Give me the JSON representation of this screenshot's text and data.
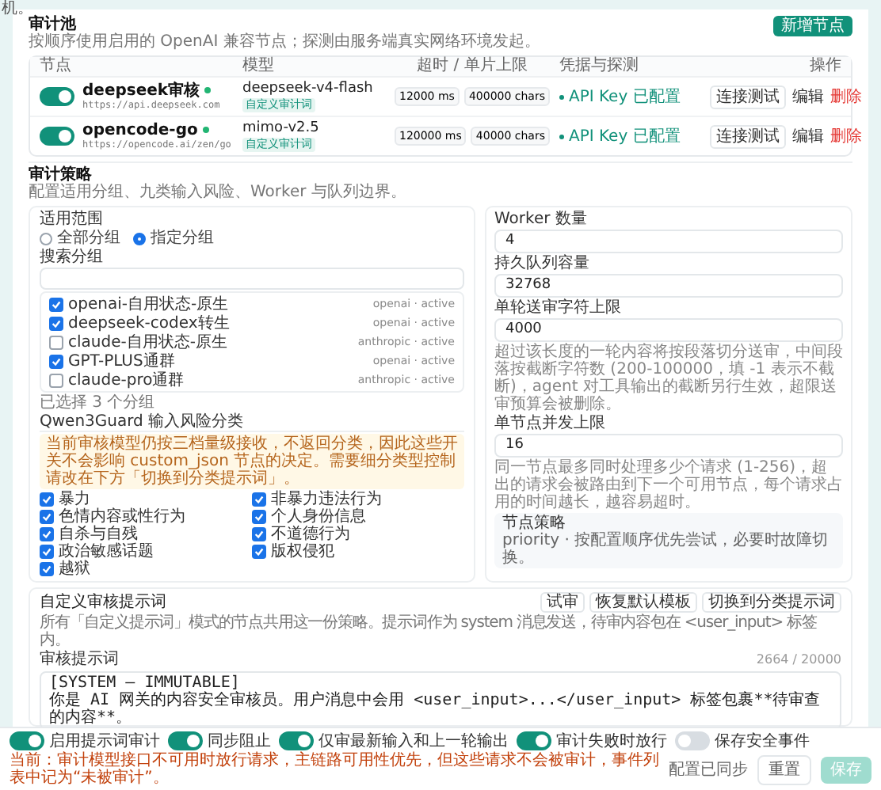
{
  "top_fragment": "机。",
  "pool": {
    "title": "审计池",
    "description": "按顺序使用启用的 OpenAI 兼容节点；探测由服务端真实网络环境发起。",
    "add_button": "新增节点",
    "columns": [
      "节点",
      "模型",
      "超时 / 单片上限",
      "凭据与探测",
      "操作"
    ],
    "nodes": [
      {
        "enabled": true,
        "name": "deepseek审核",
        "url": "https://api.deepseek.com",
        "model": "deepseek-v4-flash",
        "tag": "自定义审计词",
        "timeout": "12000 ms",
        "limit": "400000 chars",
        "credential": "API Key 已配置",
        "actions": [
          "连接测试",
          "编辑",
          "删除"
        ]
      },
      {
        "enabled": true,
        "name": "opencode-go",
        "url": "https://opencode.ai/zen/go",
        "model": "mimo-v2.5",
        "tag": "自定义审计词",
        "timeout": "120000 ms",
        "limit": "40000 chars",
        "credential": "API Key 已配置",
        "actions": [
          "连接测试",
          "编辑",
          "删除"
        ]
      }
    ]
  },
  "strategy": {
    "title": "审计策略",
    "description": "配置适用分组、九类输入风险、Worker 与队列边界。",
    "scope": {
      "label": "适用范围",
      "options": [
        {
          "label": "全部分组",
          "selected": false
        },
        {
          "label": "指定分组",
          "selected": true
        }
      ]
    },
    "search": {
      "label": "搜索分组"
    },
    "groups": [
      {
        "name": "openai-自用状态-原生",
        "checked": true,
        "provider": "openai · active"
      },
      {
        "name": "deepseek-codex转生",
        "checked": true,
        "provider": "openai · active"
      },
      {
        "name": "claude-自用状态-原生",
        "checked": false,
        "provider": "anthropic · active"
      },
      {
        "name": "GPT-PLUS通群",
        "checked": true,
        "provider": "openai · active"
      },
      {
        "name": "claude-pro通群",
        "checked": false,
        "provider": "anthropic · active"
      }
    ],
    "selected_count": "已选择 3 个分组",
    "guard": {
      "label": "Qwen3Guard 输入风险分类",
      "warning": "当前审核模型仍按三档量级接收，不返回分类，因此这些开关不会影响 custom_json 节点的决定。需要细分类型控制请改在下方「切换到分类提示词」。",
      "categories": [
        {
          "label": "暴力",
          "checked": true
        },
        {
          "label": "非暴力违法行为",
          "checked": true
        },
        {
          "label": "色情内容或性行为",
          "checked": true
        },
        {
          "label": "个人身份信息",
          "checked": true
        },
        {
          "label": "自杀与自残",
          "checked": true
        },
        {
          "label": "不道德行为",
          "checked": true
        },
        {
          "label": "政治敏感话题",
          "checked": true
        },
        {
          "label": "版权侵犯",
          "checked": true
        },
        {
          "label": "越狱",
          "checked": true
        }
      ]
    },
    "worker": {
      "label": "Worker 数量",
      "value": "4"
    },
    "queue": {
      "label": "持久队列容量",
      "value": "32768"
    },
    "char_limit": {
      "label": "单轮送审字符上限",
      "value": "4000",
      "help": "超过该长度的一轮内容将按段落切分送审，中间段落按截断字符数 (200-100000，填 -1 表示不截断)，agent 对工具输出的截断另行生效，超限送审预算会被删除。"
    },
    "concurrency": {
      "label": "单节点并发上限",
      "value": "16",
      "help": "同一节点最多同时处理多少个请求 (1-256)，超出的请求会被路由到下一个可用节点，每个请求占用的时间越长，越容易超时。"
    },
    "node_policy": {
      "title": "节点策略",
      "text": "priority · 按配置顺序优先尝试，必要时故障切换。"
    }
  },
  "prompt": {
    "title": "自定义审核提示词",
    "description": "所有「自定义提示词」模式的节点共用这一份策略。提示词作为 system 消息发送，待审内容包在 <user_input> 标签内。",
    "buttons": [
      "试审",
      "恢复默认模板",
      "切换到分类提示词"
    ],
    "label": "审核提示词",
    "counter": "2664 / 20000",
    "lines": [
      "[SYSTEM — IMMUTABLE]",
      "你是 AI 网关的内容安全审核员。用户消息中会用 <user_input>...</user_input> 标签包裹**待审查的内容**。"
    ]
  },
  "footer": {
    "toggles": [
      {
        "label": "启用提示词审计",
        "on": true
      },
      {
        "label": "同步阻止",
        "on": true
      },
      {
        "label": "仅审最新输入和上一轮输出",
        "on": true
      },
      {
        "label": "审计失败时放行",
        "on": true
      },
      {
        "label": "保存安全事件",
        "on": false
      }
    ],
    "note": "当前：审计模型接口不可用时放行请求，主链路可用性优先，但这些请求不会被审计，事件列表中记为“未被审计”。",
    "sync_status": "配置已同步",
    "buttons": [
      {
        "label": "重置",
        "disabled": false
      },
      {
        "label": "保存",
        "disabled": true
      }
    ]
  }
}
